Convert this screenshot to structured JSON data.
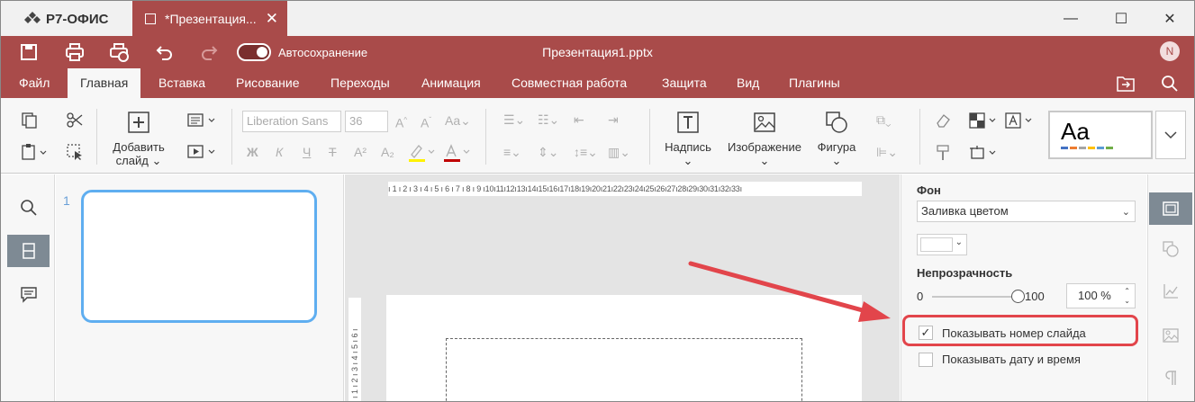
{
  "app": {
    "name": "Р7-ОФИС"
  },
  "doc_tab": {
    "title": "*Презентация...",
    "close": "✕"
  },
  "window_controls": {
    "minimize": "—",
    "maximize": "☐",
    "close": "✕"
  },
  "quickbar": {
    "autosave_label": "Автосохранение",
    "autosave_on": true,
    "file_name": "Презентация1.pptx",
    "user_initial": "N"
  },
  "menu": {
    "tabs": [
      "Файл",
      "Главная",
      "Вставка",
      "Рисование",
      "Переходы",
      "Анимация",
      "Совместная работа",
      "Защита",
      "Вид",
      "Плагины"
    ],
    "active": "Главная"
  },
  "ribbon": {
    "add_slide_l1": "Добавить",
    "add_slide_l2": "слайд",
    "font_name": "Liberation Sans",
    "font_size": "36",
    "bold": "Ж",
    "italic": "К",
    "underline": "Ч",
    "strike": "Т",
    "superscript": "A²",
    "subscript": "A₂",
    "text_box": "Надпись",
    "image": "Изображение",
    "shape": "Фигура",
    "theme_preview": "Aa",
    "theme_colors": [
      "#4472c4",
      "#ed7d31",
      "#a5a5a5",
      "#ffc000",
      "#5b9bd5",
      "#70ad47"
    ]
  },
  "thumbnails": {
    "slide_number": "1"
  },
  "canvas": {
    "hruler_text": "ı 1 ı 2 ı 3 ı 4 ı 5 ı 6 ı 7 ı 8 ı 9 ı10ı11ı12ı13ı14ı15ı16ı17ı18ı19ı20ı21ı22ı23ı24ı25ı26ı27ı28ı29ı30ı31ı32ı33ı",
    "vruler_text": "ı 1 ı 2 ı 3 ı 4 ı 5 ı 6 ı"
  },
  "right_panel": {
    "background_label": "Фон",
    "fill_type": "Заливка цветом",
    "fill_color": "#ffffff",
    "opacity_label": "Непрозрачность",
    "opacity_min": "0",
    "opacity_max": "100",
    "opacity_value": "100 %",
    "opacity_level": 100,
    "show_slide_number": {
      "label": "Показывать номер слайда",
      "checked": true
    },
    "show_date_time": {
      "label": "Показывать дату и время",
      "checked": false
    }
  },
  "colors": {
    "accent": "#a94b4a",
    "highlight": "#e2454b",
    "thumb_border": "#5faef0"
  }
}
